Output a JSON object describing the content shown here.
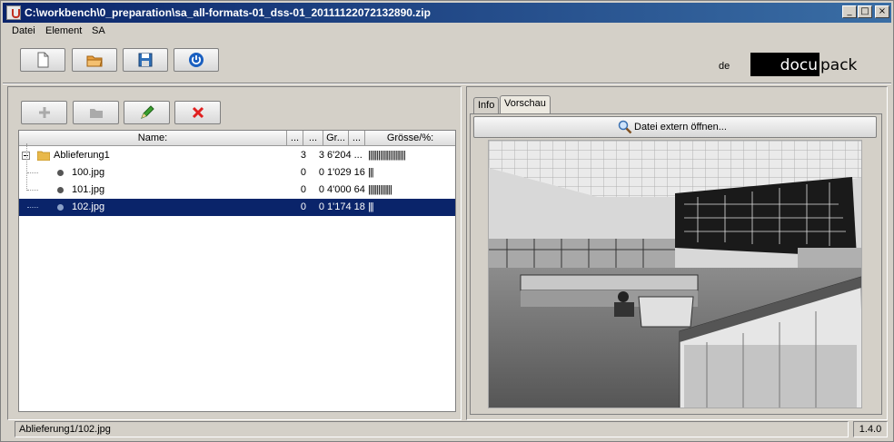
{
  "window": {
    "title": "C:\\workbench\\0_preparation\\sa_all-formats-01_dss-01_20111122072132890.zip"
  },
  "menu": [
    "Datei",
    "Element",
    "SA"
  ],
  "toolbar": {
    "buttons": [
      {
        "name": "new-document-button",
        "icon": "new-document-icon"
      },
      {
        "name": "open-folder-button",
        "icon": "open-folder-icon"
      },
      {
        "name": "save-button",
        "icon": "floppy-disk-icon"
      },
      {
        "name": "power-button",
        "icon": "power-icon"
      }
    ]
  },
  "header": {
    "language": "de",
    "logo_dark": "docu",
    "logo_light": "pack"
  },
  "edit_toolbar": {
    "buttons": [
      {
        "name": "add-button",
        "icon": "plus-icon",
        "enabled": false
      },
      {
        "name": "add-folder-button",
        "icon": "folder-icon",
        "enabled": false
      },
      {
        "name": "edit-button",
        "icon": "pencil-icon",
        "enabled": true
      },
      {
        "name": "delete-button",
        "icon": "red-x-icon",
        "enabled": true
      }
    ]
  },
  "tree": {
    "columns": [
      "Name:",
      "...",
      "...",
      "Gr...",
      "...",
      "Grösse/%:"
    ],
    "rows": [
      {
        "name": "Ablieferung1",
        "type": "folder",
        "c1": "3",
        "c2": "3",
        "c3": "6'204 ...",
        "bars": "||||||||||||||||||||||",
        "selected": false
      },
      {
        "name": "100.jpg",
        "type": "file",
        "c1": "0",
        "c2": "0",
        "c3": "1'029 16",
        "bars": "|||",
        "selected": false
      },
      {
        "name": "101.jpg",
        "type": "file",
        "c1": "0",
        "c2": "0",
        "c3": "4'000 64",
        "bars": "||||||||||||||",
        "selected": false
      },
      {
        "name": "102.jpg",
        "type": "file",
        "c1": "0",
        "c2": "0",
        "c3": "1'174 18",
        "bars": "|||",
        "selected": true
      }
    ]
  },
  "tabs": [
    {
      "label": "Info",
      "active": false
    },
    {
      "label": "Vorschau",
      "active": true
    }
  ],
  "preview": {
    "open_button_label": "Datei extern öffnen..."
  },
  "status": {
    "path": "Ablieferung1/102.jpg",
    "version": "1.4.0"
  },
  "colors": {
    "title_start": "#0a246a",
    "title_end": "#3a6ea5",
    "selection": "#0a246a",
    "window_bg": "#d4d0c8"
  }
}
